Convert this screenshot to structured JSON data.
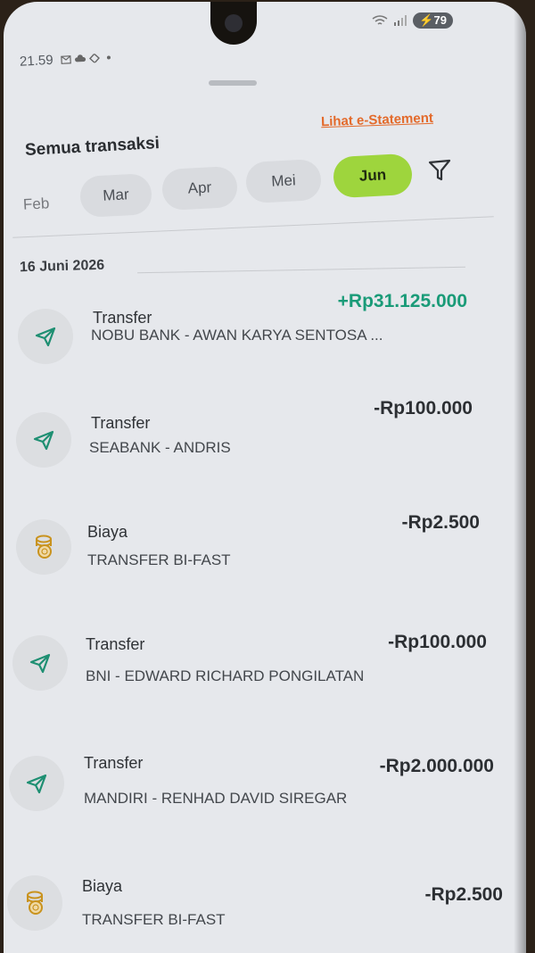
{
  "status_bar": {
    "time": "21.59",
    "battery": "79",
    "icons": [
      "gmail-icon",
      "cloud-icon",
      "location-icon",
      "dot-icon",
      "wifi-icon",
      "signal-icon"
    ]
  },
  "header": {
    "title": "Semua transaksi",
    "estatement_link": "Lihat e-Statement"
  },
  "months": [
    {
      "label": "Feb"
    },
    {
      "label": "Mar"
    },
    {
      "label": "Apr"
    },
    {
      "label": "Mei"
    },
    {
      "label": "Jun",
      "selected": true
    }
  ],
  "date_header": "16 Juni 2026",
  "transactions": [
    {
      "icon": "send-icon",
      "type": "Transfer",
      "description": "NOBU BANK - AWAN KARYA SENTOSA ...",
      "amount": "+Rp31.125.000"
    },
    {
      "icon": "send-icon",
      "type": "Transfer",
      "description": "SEABANK - ANDRIS",
      "amount": "-Rp100.000"
    },
    {
      "icon": "fee-coins-icon",
      "type": "Biaya",
      "description": "TRANSFER BI-FAST",
      "amount": "-Rp2.500"
    },
    {
      "icon": "send-icon",
      "type": "Transfer",
      "description": "BNI - EDWARD RICHARD PONGILATAN",
      "amount": "-Rp100.000"
    },
    {
      "icon": "send-icon",
      "type": "Transfer",
      "description": "MANDIRI - RENHAD DAVID SIREGAR",
      "amount": "-Rp2.000.000"
    },
    {
      "icon": "fee-coins-icon",
      "type": "Biaya",
      "description": "TRANSFER BI-FAST",
      "amount": "-Rp2.500"
    }
  ],
  "colors": {
    "accent": "#9ed53d",
    "positive": "#1a9b78",
    "link": "#e36a2b",
    "send_icon": "#1e8f72",
    "fee_icon": "#c9931e"
  }
}
